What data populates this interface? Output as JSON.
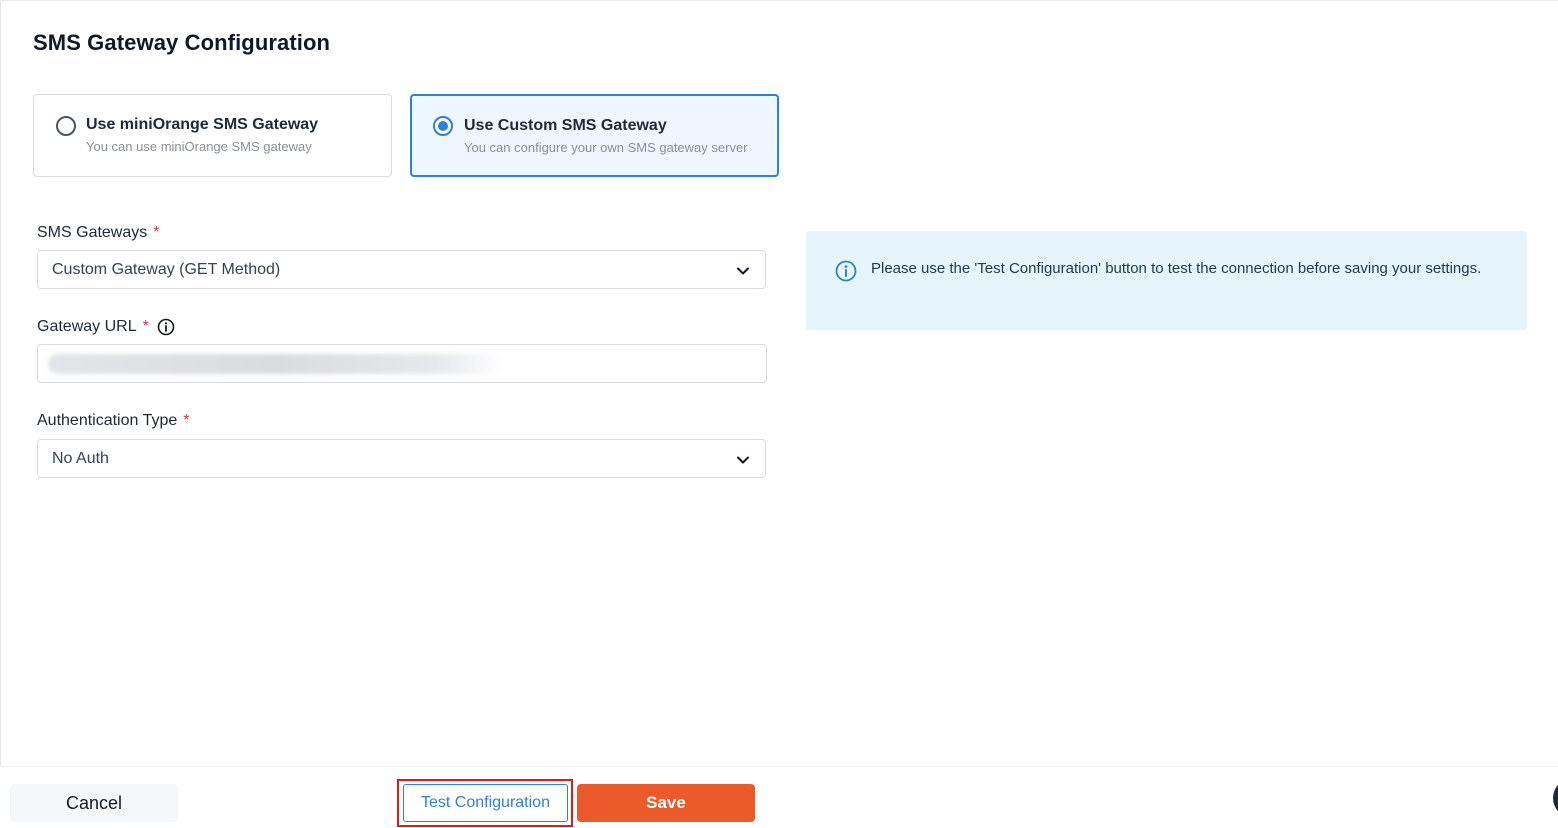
{
  "page": {
    "title": "SMS Gateway Configuration"
  },
  "gateway_options": [
    {
      "title": "Use miniOrange SMS Gateway",
      "description": "You can use miniOrange SMS gateway",
      "selected": false
    },
    {
      "title": "Use Custom SMS Gateway",
      "description": "You can configure your own SMS gateway server",
      "selected": true
    }
  ],
  "form": {
    "sms_gateways": {
      "label": "SMS Gateways",
      "required_mark": "*",
      "value": "Custom Gateway (GET Method)"
    },
    "gateway_url": {
      "label": "Gateway URL",
      "required_mark": "*"
    },
    "auth_type": {
      "label": "Authentication Type",
      "required_mark": "*",
      "value": "No Auth"
    }
  },
  "info_panel": {
    "text": "Please use the 'Test Configuration' button to test the connection before saving your settings."
  },
  "footer": {
    "cancel_label": "Cancel",
    "test_label": "Test Configuration",
    "save_label": "Save"
  },
  "icons": {
    "radio": "radio-icon",
    "chevron": "chevron-down-icon",
    "info": "info-icon"
  },
  "colors": {
    "accent": "#2f80d8",
    "save": "#ec5a2c",
    "required": "#e53935",
    "info_bg": "#e6f4fb",
    "highlight": "#d62020"
  }
}
